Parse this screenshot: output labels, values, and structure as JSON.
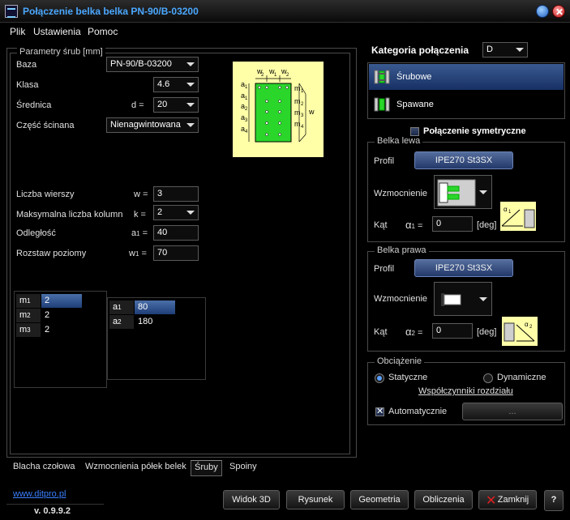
{
  "window": {
    "title": "Połączenie belka belka  PN-90/B-03200"
  },
  "menu": [
    "Plik",
    "Ustawienia",
    "Pomoc"
  ],
  "bolt_params": {
    "group_title": "Parametry śrub [mm]",
    "baza_label": "Baza",
    "baza_value": "PN-90/B-03200",
    "klasa_label": "Klasa",
    "klasa_value": "4.6",
    "srednica_label": "Średnica",
    "srednica_symbol": "d =",
    "srednica_value": "20",
    "czesc_label": "Część ścinana",
    "czesc_value": "Nienagwintowana",
    "wiersze_label": "Liczba wierszy",
    "wiersze_symbol": "w =",
    "wiersze_value": "3",
    "kolumny_label": "Maksymalna liczba kolumn",
    "kolumny_symbol": "k =",
    "kolumny_value": "2",
    "odleglosc_label": "Odległość",
    "odleglosc_symbol": "a",
    "odleglosc_sub": "1",
    "odleglosc_eq": " =",
    "odleglosc_value": "40",
    "rozstaw_label": "Rozstaw poziomy",
    "rozstaw_symbol": "w",
    "rozstaw_sub": "1",
    "rozstaw_eq": " =",
    "rozstaw_value": "70"
  },
  "m_table": [
    {
      "label": "m",
      "sub": "1",
      "value": "2"
    },
    {
      "label": "m",
      "sub": "2",
      "value": "2"
    },
    {
      "label": "m",
      "sub": "3",
      "value": "2"
    }
  ],
  "a_table": [
    {
      "label": "a",
      "sub": "1",
      "value": "80"
    },
    {
      "label": "a",
      "sub": "2",
      "value": "180"
    }
  ],
  "tabs": [
    "Blacha czołowa",
    "Wzmocnienia półek belek",
    "Śruby",
    "Spoiny"
  ],
  "active_tab": "Śruby",
  "footer": {
    "link": "www.ditpro.pl",
    "version": "v. 0.9.9.2"
  },
  "buttons": {
    "widok": "Widok 3D",
    "rysunek": "Rysunek",
    "geometria": "Geometria",
    "obliczenia": "Obliczenia",
    "zamknij": "Zamknij",
    "help": "?"
  },
  "category": {
    "label": "Kategoria połączenia",
    "value": "D",
    "options": [
      "Śrubowe",
      "Spawane"
    ]
  },
  "symmetric": {
    "label": "Połączenie symetryczne",
    "checked": false
  },
  "belka_lewa": {
    "title": "Belka lewa",
    "profil_label": "Profil",
    "profil_value": "IPE270 St3SX",
    "wzm_label": "Wzmocnienie",
    "kat_label": "Kąt",
    "kat_symbol": "α",
    "kat_sub": "1",
    "kat_eq": " =",
    "kat_value": "0",
    "kat_unit": "[deg]"
  },
  "belka_prawa": {
    "title": "Belka prawa",
    "profil_label": "Profil",
    "profil_value": "IPE270 St3SX",
    "wzm_label": "Wzmocnienie",
    "kat_label": "Kąt",
    "kat_symbol": "α",
    "kat_sub": "2",
    "kat_eq": " =",
    "kat_value": "0",
    "kat_unit": "[deg]"
  },
  "obciazenie": {
    "title": "Obciążenie",
    "opt1": "Statyczne",
    "opt2": "Dynamiczne",
    "selected": "Statyczne",
    "link": "Współczynniki rozdziału",
    "auto_label": "Automatycznie",
    "auto_checked": true,
    "auto_button": "..."
  },
  "diagram_labels": {
    "w2": "w",
    "w1": "w",
    "a1": "a",
    "a2": "a",
    "a3": "a",
    "a4": "a",
    "m1": "m",
    "m2": "m",
    "m3": "m",
    "m4": "m",
    "w": "w"
  },
  "colors": {
    "accent": "#4aa8ff",
    "selection": "#1f3e78",
    "diagram_bg": "#ffffa8",
    "plate": "#2bd62b"
  }
}
